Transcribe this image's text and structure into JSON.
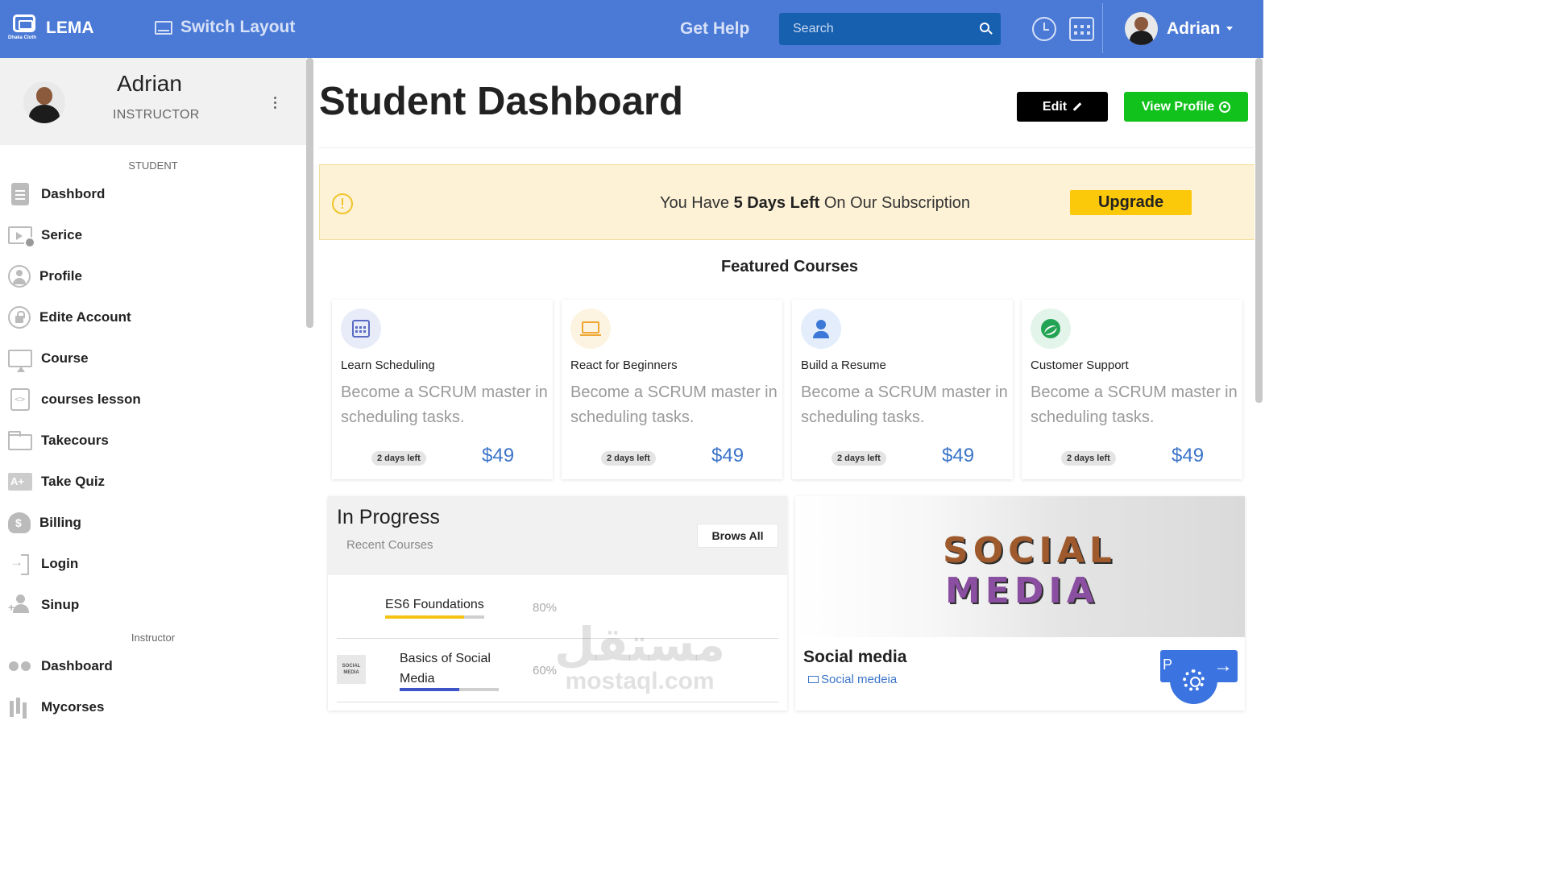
{
  "topbar": {
    "brand_name": "LEMA",
    "brand_tagline": "Dhaka Cloth",
    "switch_layout_label": "Switch Layout",
    "get_help_label": "Get Help",
    "search_placeholder": "Search",
    "user_name": "Adrian"
  },
  "sidebar": {
    "profile": {
      "name": "Adrian",
      "role": "INSTRUCTOR"
    },
    "section_student": "STUDENT",
    "student_items": [
      {
        "label": "Dashbord",
        "icon": "clipboard-icon"
      },
      {
        "label": "Serice",
        "icon": "video-settings-icon"
      },
      {
        "label": "Profile",
        "icon": "user-circle-icon"
      },
      {
        "label": "Edite Account",
        "icon": "lock-icon"
      },
      {
        "label": "Course",
        "icon": "presentation-icon"
      },
      {
        "label": "courses lesson",
        "icon": "code-file-icon"
      },
      {
        "label": "Takecours",
        "icon": "folder-open-icon"
      },
      {
        "label": "Take Quiz",
        "icon": "quiz-grade-icon"
      },
      {
        "label": "Billing",
        "icon": "money-bag-icon"
      },
      {
        "label": "Login",
        "icon": "login-icon"
      },
      {
        "label": "Sinup",
        "icon": "add-user-icon"
      }
    ],
    "section_instructor": "Instructor",
    "instructor_items": [
      {
        "label": "Dashboard",
        "icon": "glasses-icon"
      },
      {
        "label": "Mycorses",
        "icon": "bar-chart-icon"
      }
    ]
  },
  "main": {
    "title": "Student Dashboard",
    "edit_label": "Edit",
    "view_profile_label": "View Profile",
    "alert": {
      "prefix": "You Have ",
      "highlight": "5 Days Left",
      "suffix": " On Our Subscription",
      "upgrade_label": "Upgrade"
    },
    "featured_title": "Featured Courses",
    "courses": [
      {
        "title": "Learn Scheduling",
        "description": "Become a SCRUM master in scheduling tasks.",
        "badge": "2 days left",
        "price": "$49",
        "icon": "calendar-icon"
      },
      {
        "title": "React for Beginners",
        "description": "Become a SCRUM master in scheduling tasks.",
        "badge": "2 days left",
        "price": "$49",
        "icon": "laptop-icon"
      },
      {
        "title": "Build a Resume",
        "description": "Become a SCRUM master in scheduling tasks.",
        "badge": "2 days left",
        "price": "$49",
        "icon": "user-icon"
      },
      {
        "title": "Customer Support",
        "description": "Become a SCRUM master in scheduling tasks.",
        "badge": "2 days left",
        "price": "$49",
        "icon": "volleyball-icon"
      }
    ],
    "in_progress": {
      "title": "In Progress",
      "subtitle": "Recent Courses",
      "browse_label": "Brows All",
      "items": [
        {
          "name": "ES6 Foundations",
          "percent_label": "80%",
          "progress": 0.8,
          "color": "#f5c211"
        },
        {
          "name": "Basics of Social Media",
          "percent_label": "60%",
          "progress": 0.6,
          "color": "#3d55c8",
          "thumb_text": "SOCIAL MEDIA"
        }
      ]
    },
    "social_card": {
      "image_line1": "SOCIAL",
      "image_line2": "MEDIA",
      "title": "Social media",
      "link_label": "Social medeia"
    },
    "fab_letter": "P"
  },
  "watermark": {
    "line1": "مستقل",
    "line2": "mostaql.com"
  },
  "colors": {
    "topbar": "#4a79d6",
    "search": "#1760b0",
    "edit_button": "#000000",
    "view_profile_button": "#12c21c",
    "alert_bg": "#fdf2d6",
    "upgrade_button": "#fcc80a",
    "price": "#3b74c9"
  }
}
